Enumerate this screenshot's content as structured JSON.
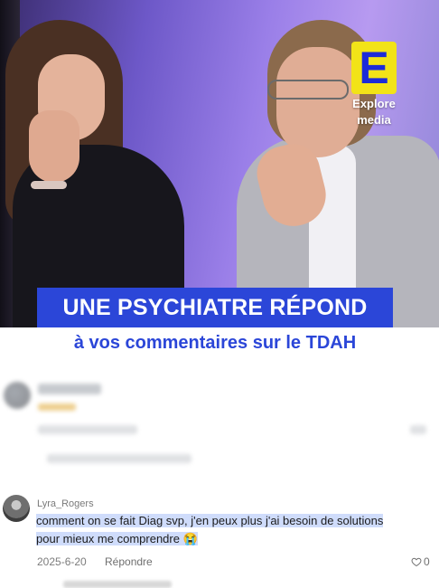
{
  "video": {
    "logo_letter": "E",
    "logo_line1": "Explore",
    "logo_line2": "media",
    "headline": "UNE PSYCHIATRE RÉPOND",
    "subheadline": "à vos commentaires sur le TDAH",
    "colors": {
      "headline_bg": "#2b46d8",
      "logo_bg": "#f2e318",
      "logo_letter": "#1d2bd8"
    }
  },
  "comment": {
    "username": "Lyra_Rogers",
    "text": "comment on se fait Diag svp, j'en peux plus j'ai besoin de solutions pour mieux me comprendre 😭",
    "date": "2025-6-20",
    "reply_label": "Répondre",
    "like_icon": "heart-icon",
    "like_count": "0",
    "highlight_color": "#cfdcfb"
  }
}
